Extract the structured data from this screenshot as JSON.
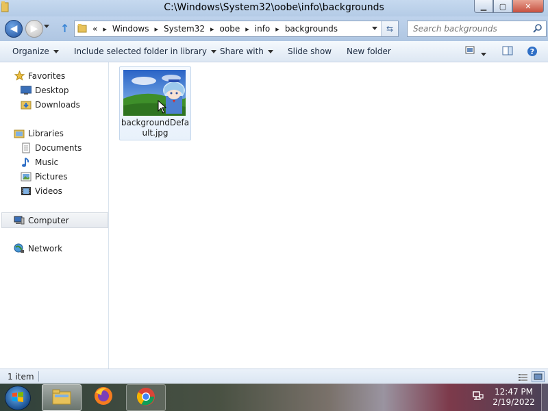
{
  "window": {
    "title": "C:\\Windows\\System32\\oobe\\info\\backgrounds",
    "buttons": {
      "minimize_icon": "minimize-icon",
      "maximize_icon": "maximize-icon",
      "close_icon": "close-icon"
    }
  },
  "address_bar": {
    "overflow": "«",
    "breadcrumb": [
      "Windows",
      "System32",
      "oobe",
      "info",
      "backgrounds"
    ],
    "separator": "▸"
  },
  "search": {
    "placeholder": "Search backgrounds"
  },
  "command_bar": {
    "items": [
      "Organize",
      "Include selected folder in library",
      "Share with",
      "Slide show",
      "New folder"
    ]
  },
  "nav_pane": {
    "favorites": {
      "label": "Favorites",
      "items": [
        "Desktop",
        "Downloads"
      ]
    },
    "libraries": {
      "label": "Libraries",
      "items": [
        "Documents",
        "Music",
        "Pictures",
        "Videos"
      ]
    },
    "computer": {
      "label": "Computer"
    },
    "network": {
      "label": "Network"
    }
  },
  "content": {
    "files": [
      {
        "name": "backgroundDefault.jpg",
        "type": "jpg"
      }
    ]
  },
  "status_bar": {
    "item_count": "1 item"
  },
  "taskbar": {
    "pinned": [
      "windows-explorer",
      "firefox",
      "chrome"
    ],
    "clock": {
      "time": "12:47 PM",
      "date": "2/19/2022"
    }
  },
  "colors": {
    "accent": "#3b86d6",
    "titlebar": "#c6d9ef",
    "close": "#c75040"
  }
}
